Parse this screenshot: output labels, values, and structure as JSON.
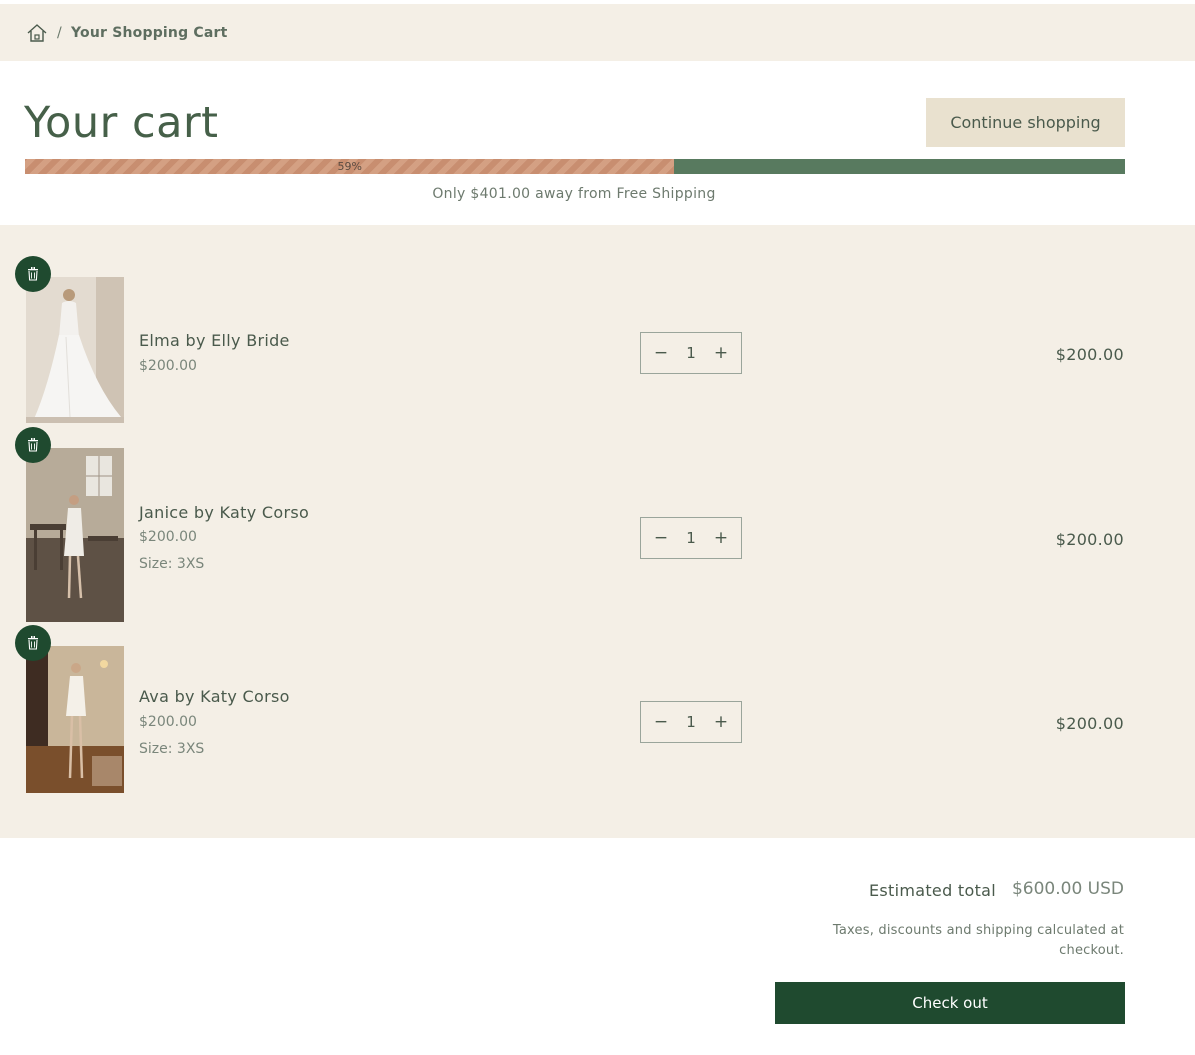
{
  "breadcrumb": {
    "separator": "/",
    "current": "Your Shopping Cart"
  },
  "header": {
    "title": "Your cart",
    "continue_label": "Continue shopping"
  },
  "shipping_progress": {
    "percent_label": "59%",
    "fraction": 0.59,
    "message": "Only $401.00 away from Free Shipping"
  },
  "items": [
    {
      "name": "Elma by Elly Bride",
      "price": "$200.00",
      "size": "",
      "quantity": "1",
      "total": "$200.00"
    },
    {
      "name": "Janice by Katy Corso",
      "price": "$200.00",
      "size": "Size: 3XS",
      "quantity": "1",
      "total": "$200.00"
    },
    {
      "name": "Ava by Katy Corso",
      "price": "$200.00",
      "size": "Size: 3XS",
      "quantity": "1",
      "total": "$200.00"
    }
  ],
  "summary": {
    "estimated_label": "Estimated total",
    "estimated_value": "$600.00 USD",
    "tax_note": "Taxes, discounts and shipping calculated at checkout.",
    "checkout_label": "Check out"
  },
  "colors": {
    "accent_green": "#1f4a2f",
    "progress_green": "#587a5f",
    "progress_fill": "#c88e70",
    "panel_bg": "#f4efe6"
  }
}
